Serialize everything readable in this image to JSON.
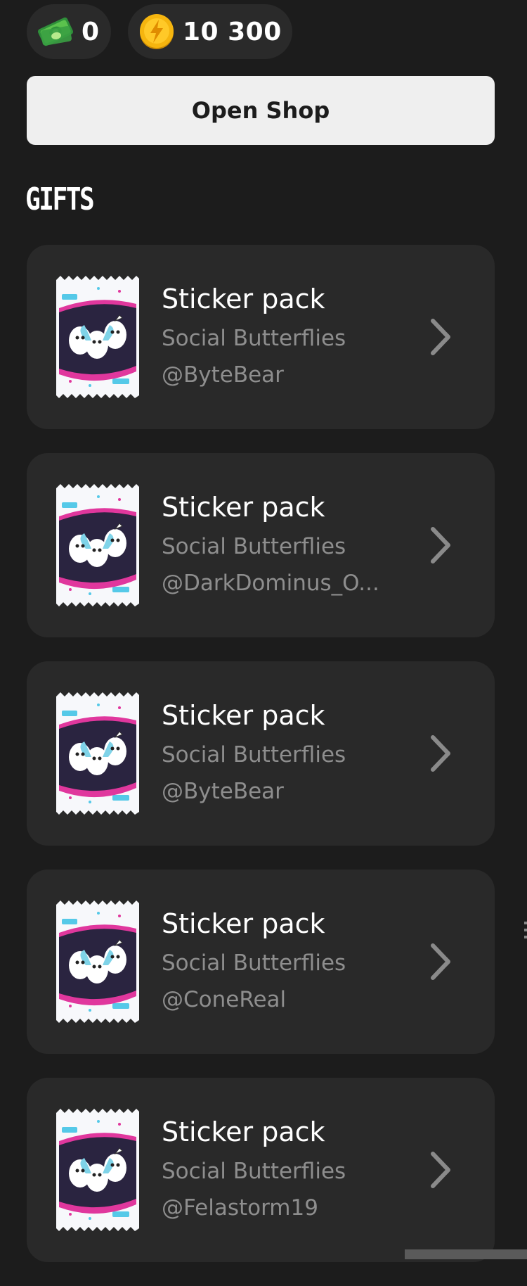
{
  "currencies": {
    "cash": {
      "icon": "cash-banknote-icon",
      "value": "0"
    },
    "coins": {
      "icon": "lightning-coin-icon",
      "value": "10 300"
    }
  },
  "shop_button": {
    "label": "Open Shop"
  },
  "gifts_section": {
    "title": "GIFTS",
    "items": [
      {
        "title": "Sticker pack",
        "subtitle": "Social Butterflies",
        "user": "@ByteBear",
        "icon": "sticker-pack-icon"
      },
      {
        "title": "Sticker pack",
        "subtitle": "Social Butterflies",
        "user": "@DarkDominus_O...",
        "icon": "sticker-pack-icon"
      },
      {
        "title": "Sticker pack",
        "subtitle": "Social Butterflies",
        "user": "@ByteBear",
        "icon": "sticker-pack-icon"
      },
      {
        "title": "Sticker pack",
        "subtitle": "Social Butterflies",
        "user": "@ConeReal",
        "icon": "sticker-pack-icon"
      },
      {
        "title": "Sticker pack",
        "subtitle": "Social Butterflies",
        "user": "@Felastorm19",
        "icon": "sticker-pack-icon"
      }
    ]
  },
  "colors": {
    "background": "#1c1c1c",
    "card": "#292929",
    "button": "#efefef",
    "secondary_text": "#8e8e8e",
    "coin_gold": "#f5b50f",
    "cash_green": "#52b648",
    "pack_pink": "#e0379d",
    "pack_cyan": "#37c6e0"
  }
}
